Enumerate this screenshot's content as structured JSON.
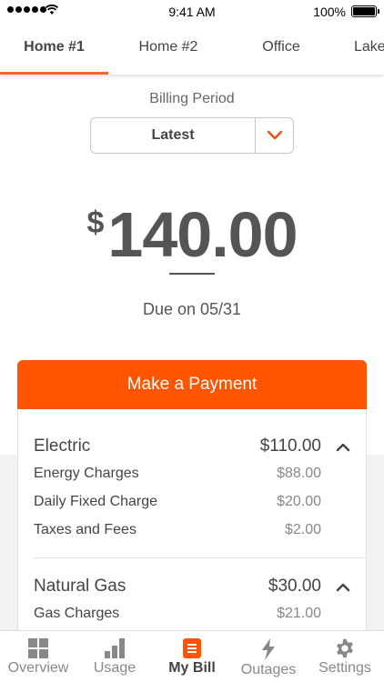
{
  "status_bar": {
    "time": "9:41 AM",
    "battery_percent": "100%",
    "battery_level": 1.0
  },
  "tabs": [
    {
      "label": "Home #1",
      "active": true
    },
    {
      "label": "Home #2",
      "active": false
    },
    {
      "label": "Office",
      "active": false
    },
    {
      "label": "Lake",
      "active": false
    }
  ],
  "billing": {
    "period_label": "Billing Period",
    "period_value": "Latest",
    "currency_symbol": "$",
    "amount": "140.00",
    "due_text": "Due on 05/31"
  },
  "payment": {
    "button_label": "Make a Payment"
  },
  "breakdown": [
    {
      "title": "Electric",
      "total": "$110.00",
      "expanded": true,
      "items": [
        {
          "label": "Energy Charges",
          "amount": "$88.00"
        },
        {
          "label": "Daily Fixed Charge",
          "amount": "$20.00"
        },
        {
          "label": "Taxes and Fees",
          "amount": "$2.00"
        }
      ]
    },
    {
      "title": "Natural Gas",
      "total": "$30.00",
      "expanded": true,
      "items": [
        {
          "label": "Gas Charges",
          "amount": "$21.00"
        }
      ]
    }
  ],
  "bottom_nav": [
    {
      "label": "Overview",
      "icon": "grid-icon",
      "active": false
    },
    {
      "label": "Usage",
      "icon": "bar-chart-icon",
      "active": false
    },
    {
      "label": "My Bill",
      "icon": "bill-icon",
      "active": true
    },
    {
      "label": "Outages",
      "icon": "lightning-icon",
      "active": false
    },
    {
      "label": "Settings",
      "icon": "gear-icon",
      "active": false
    }
  ],
  "colors": {
    "accent": "#ff5500",
    "tab_indicator": "#f26522",
    "text_dark": "#444444",
    "text_muted": "#888888"
  }
}
